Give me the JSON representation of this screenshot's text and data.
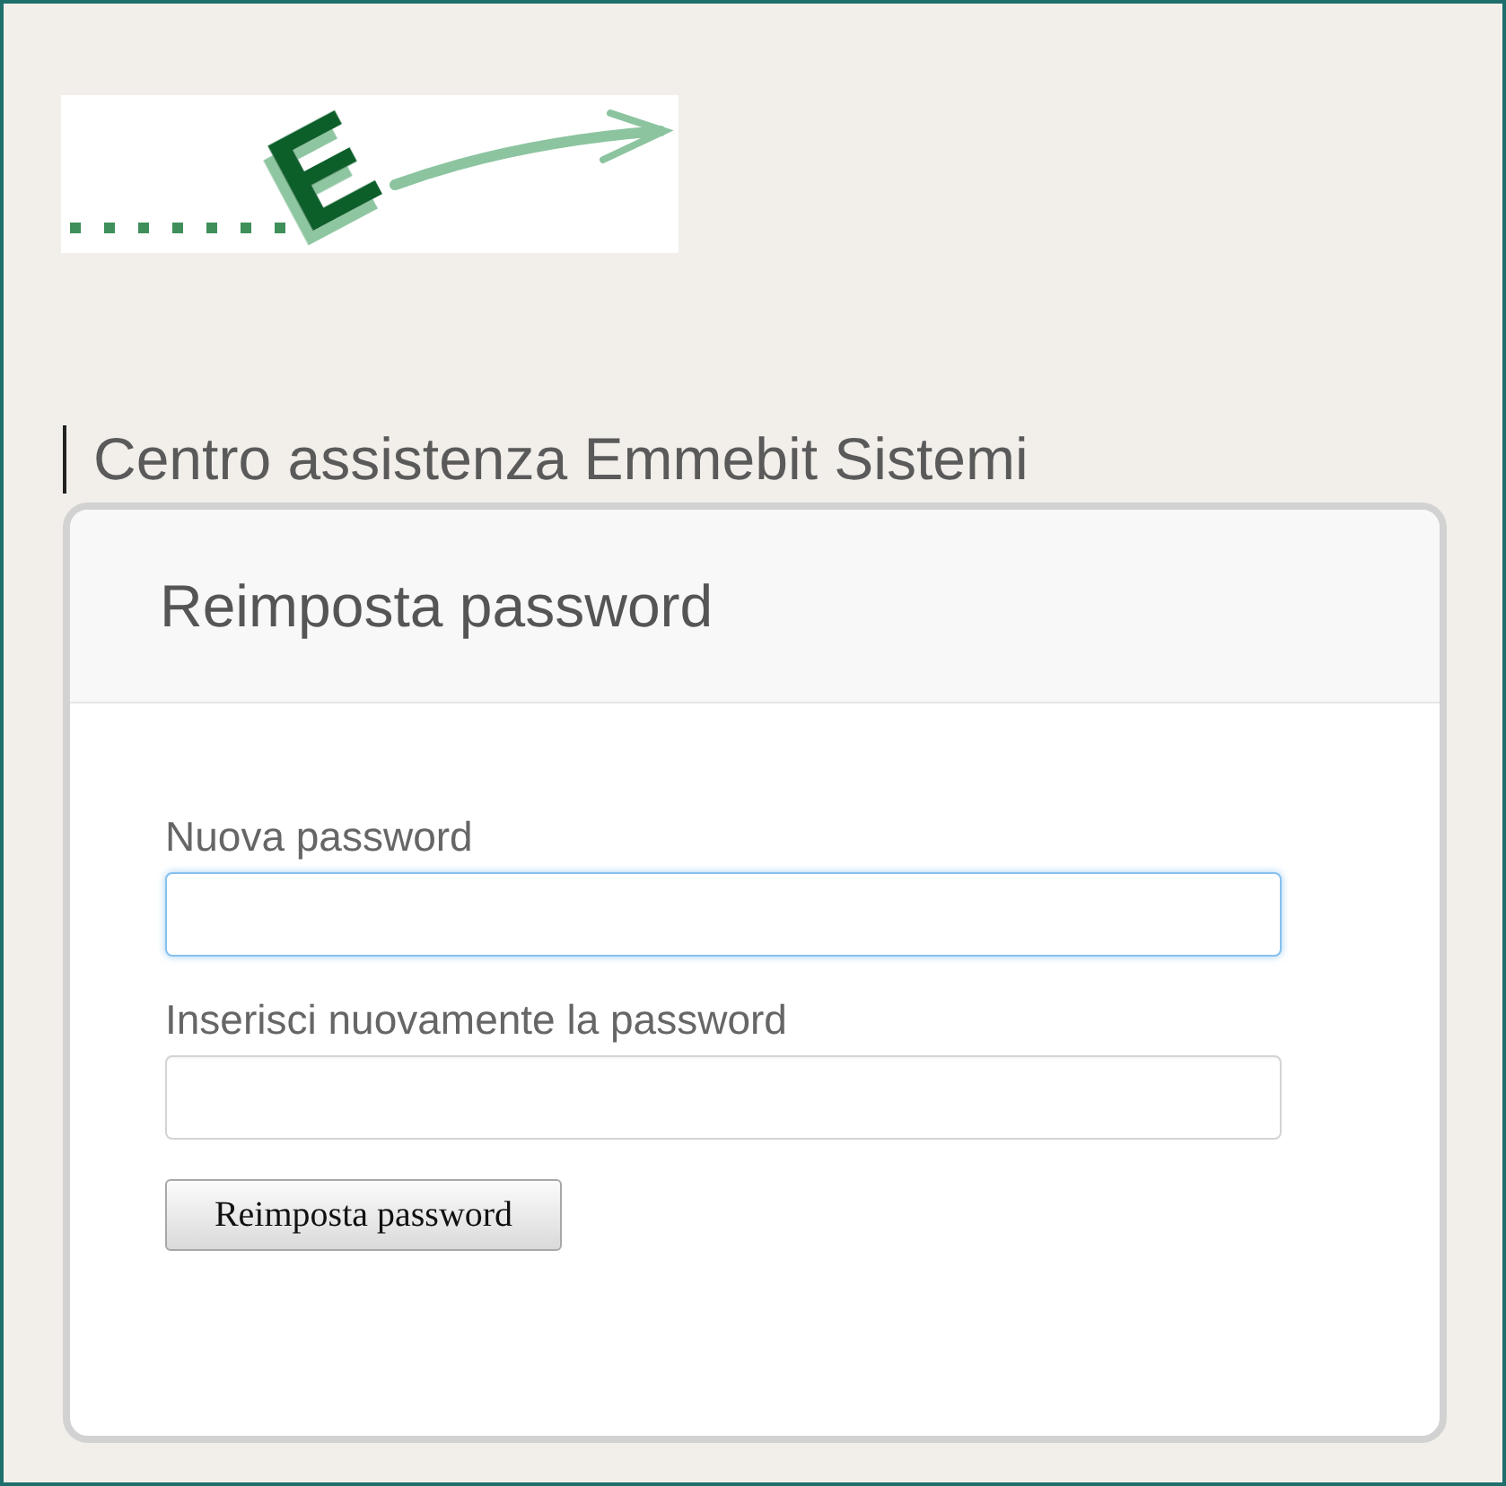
{
  "logo": {
    "letter": "E"
  },
  "heading": "Centro assistenza Emmebit Sistemi",
  "form": {
    "title": "Reimposta password",
    "fields": [
      {
        "label": "Nuova password",
        "focused": true
      },
      {
        "label": "Inserisci nuovamente la password",
        "focused": false
      }
    ],
    "submit_button": "Reimposta password"
  }
}
